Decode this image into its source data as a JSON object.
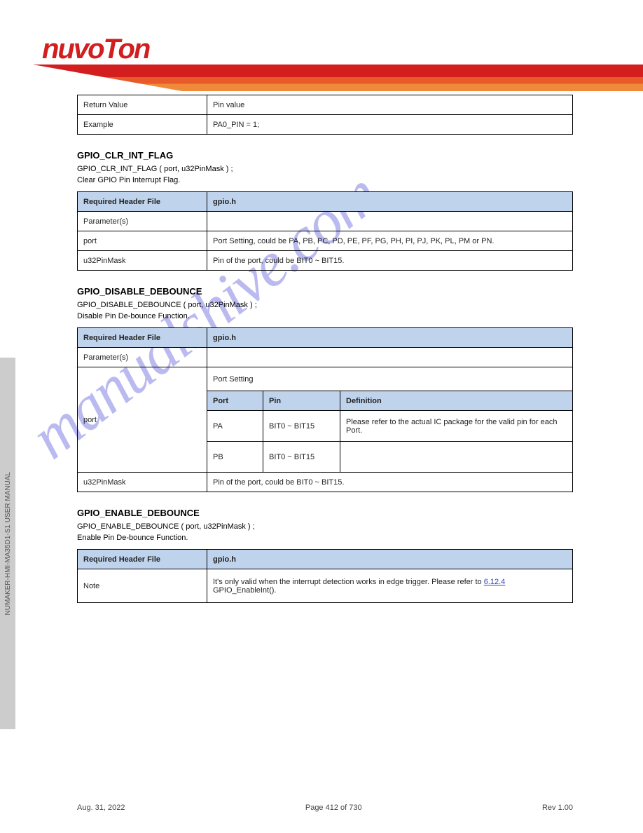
{
  "logo_text": "nuvoTon",
  "side_tab": "NUMAKER-HMI-MA35D1-S1 USER MANUAL",
  "watermark": "manualshive.com",
  "table1": {
    "rows": [
      {
        "label": "Return Value",
        "value": "Pin value"
      },
      {
        "label": "Example",
        "value": "PA0_PIN = 1;"
      }
    ]
  },
  "section1": {
    "title": "GPIO_CLR_INT_FLAG",
    "sig": "GPIO_CLR_INT_FLAG ( port, u32PinMask ) ;",
    "desc": "Clear GPIO Pin Interrupt Flag."
  },
  "table2": {
    "header": {
      "label": "Required Header File",
      "value": "gpio.h"
    },
    "rows": [
      {
        "label": "Parameter(s)",
        "value": ""
      },
      {
        "label": "port",
        "value": "Port Setting, could be PA, PB, PC, PD, PE, PF, PG, PH, PI, PJ, PK, PL, PM or PN."
      },
      {
        "label": "u32PinMask",
        "value": "Pin of the port, could be BIT0 ~ BIT15."
      }
    ]
  },
  "section2": {
    "title": "GPIO_DISABLE_DEBOUNCE",
    "sig": "GPIO_DISABLE_DEBOUNCE ( port, u32PinMask ) ;",
    "desc": "Disable Pin De-bounce Function."
  },
  "table3": {
    "header": {
      "label": "Required Header File",
      "value": "gpio.h"
    },
    "ports_label": "Parameter(s)",
    "port_label": "port",
    "port_value": "Port Setting",
    "nested": {
      "header": [
        "Port",
        "Pin",
        "Definition"
      ],
      "rows": [
        [
          "PA",
          "BIT0 ~ BIT15",
          "Please refer to the actual IC package for the valid pin for each Port."
        ],
        [
          "PB",
          "BIT0 ~ BIT15",
          ""
        ]
      ]
    },
    "mask": {
      "label": "u32PinMask",
      "value": "Pin of the port, could be BIT0 ~ BIT15."
    }
  },
  "section3": {
    "title": "GPIO_ENABLE_DEBOUNCE",
    "sig": "GPIO_ENABLE_DEBOUNCE ( port, u32PinMask ) ;",
    "desc": "Enable Pin De-bounce Function."
  },
  "table4": {
    "header": {
      "label": "Required Header File",
      "value": "gpio.h"
    },
    "note_label": "Note",
    "note_value_prefix": "It's only valid when the interrupt detection works in edge trigger. Please refer to ",
    "note_link": "6.12.4",
    "note_value_suffix": " GPIO_EnableInt()."
  },
  "footer": {
    "left": "Aug. 31, 2022",
    "center": "Page 412 of 730",
    "right": "Rev 1.00"
  }
}
